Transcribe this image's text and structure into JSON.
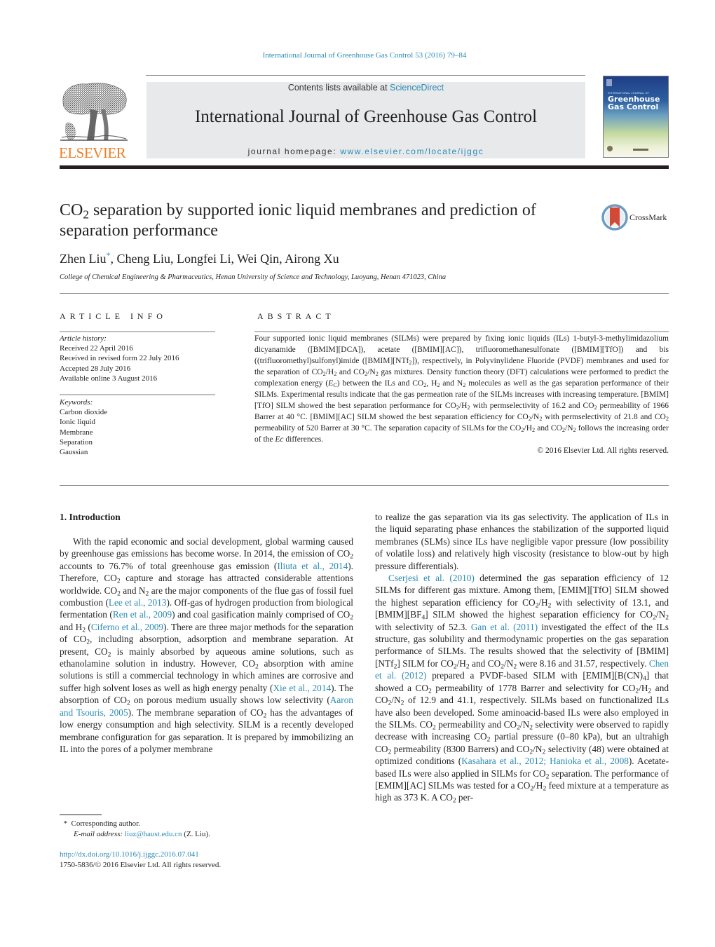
{
  "running_head": "International Journal of Greenhouse Gas Control 53 (2016) 79–84",
  "header": {
    "publisher_logo_text": "ELSEVIER",
    "contents_prefix": "Contents lists available at ",
    "contents_link": "ScienceDirect",
    "journal_title": "International Journal of Greenhouse Gas Control",
    "homepage_prefix": "journal homepage: ",
    "homepage_link": "www.elsevier.com/locate/ijggc",
    "cover": {
      "small_caption": "INTERNATIONAL JOURNAL OF",
      "title_line1": "Greenhouse",
      "title_line2": "Gas Control"
    },
    "colors": {
      "link": "#2a8bb5",
      "elsevier_orange": "#f07e26",
      "banner_bg": "#e8e9ea"
    }
  },
  "article": {
    "title_pre": "CO",
    "title_sub": "2",
    "title_post": " separation by supported ionic liquid membranes and prediction of separation performance",
    "crossmark_label": "CrossMark",
    "first_author": "Zhen Liu",
    "corresponding_mark": "*",
    "other_authors": ", Cheng Liu, Longfei Li, Wei Qin, Airong Xu",
    "affiliation": "College of Chemical Engineering & Pharmaceutics, Henan University of Science and Technology, Luoyang, Henan 471023, China"
  },
  "article_info": {
    "heading": "ARTICLE INFO",
    "history_label": "Article history:",
    "history": [
      "Received 22 April 2016",
      "Received in revised form 22 July 2016",
      "Accepted 28 July 2016",
      "Available online 3 August 2016"
    ],
    "keywords_label": "Keywords:",
    "keywords": [
      "Carbon dioxide",
      "Ionic liquid",
      "Membrane",
      "Separation",
      "Gaussian"
    ]
  },
  "abstract": {
    "heading": "ABSTRACT",
    "text_html": "Four supported ionic liquid membranes (SILMs) were prepared by fixing ionic liquids (ILs) 1-butyl-3-methylimidazolium dicyanamide ([BMIM][DCA]), acetate ([BMIM][AC]), trifluoromethanesulfonate ([BMIM][TfO]) and bis ((trifluoromethyl)sulfonyl)imide ([BMIM][NTf<span class=\"sub\">2</span>]), respectively, in Polyvinylidene Fluoride (PVDF) membranes and used for the separation of CO<span class=\"sub\">2</span>/H<span class=\"sub\">2</span> and CO<span class=\"sub\">2</span>/N<span class=\"sub\">2</span> gas mixtures. Density function theory (DFT) calculations were performed to predict the complexation energy (<i>E<span class=\"sub\">C</span></i>) between the ILs and CO<span class=\"sub\">2</span>, H<span class=\"sub\">2</span> and N<span class=\"sub\">2</span> molecules as well as the gas separation performance of their SILMs. Experimental results indicate that the gas permeation rate of the SILMs increases with increasing temperature. [BMIM][TfO] SILM showed the best separation performance for CO<span class=\"sub\">2</span>/H<span class=\"sub\">2</span> with permselectivity of 16.2 and CO<span class=\"sub\">2</span> permeability of 1966 Barrer at 40 °C. [BMIM][AC] SILM showed the best separation efficiency for CO<span class=\"sub\">2</span>/N<span class=\"sub\">2</span> with permselectivity of 21.8 and CO<span class=\"sub\">2</span> permeability of 520 Barrer at 30 °C. The separation capacity of SILMs for the CO<span class=\"sub\">2</span>/H<span class=\"sub\">2</span> and CO<span class=\"sub\">2</span>/N<span class=\"sub\">2</span> follows the increasing order of the <i>Ec</i> differences.",
    "copyright": "© 2016 Elsevier Ltd. All rights reserved."
  },
  "body": {
    "section_heading": "1.  Introduction",
    "left_col_html": "With the rapid economic and social development, global warm&shy;ing caused by greenhouse gas emissions has become worse. In 2014, the emission of CO<span class=\"sub\">2</span> accounts to 76.7% of total greenhouse gas emis&shy;sion (<a class=\"link\">Iliuta et al., 2014</a>). Therefore, CO<span class=\"sub\">2</span> capture and storage has attracted considerable attentions worldwide. CO<span class=\"sub\">2</span> and N<span class=\"sub\">2</span> are the major components of the flue gas of fossil fuel combustion (<a class=\"link\">Lee et al., 2013</a>). Off-gas of hydrogen production from biological fer&shy;mentation (<a class=\"link\">Ren et al., 2009</a>) and coal gasification mainly comprised of CO<span class=\"sub\">2</span> and H<span class=\"sub\">2</span> (<a class=\"link\">Ciferno et al., 2009</a>). There are three major meth&shy;ods for the separation of CO<span class=\"sub\">2</span>, including absorption, adsorption and membrane separation. At present, CO<span class=\"sub\">2</span> is mainly absorbed by aque&shy;ous amine solutions, such as ethanolamine solution in industry. However, CO<span class=\"sub\">2</span> absorption with amine solutions is still a commercial technology in which amines are corrosive and suffer high solvent loses as well as high energy penalty (<a class=\"link\">Xie et al., 2014</a>). The absorption of CO<span class=\"sub\">2</span> on porous medium usually shows low selectivity (<a class=\"link\">Aaron and Tsouris, 2005</a>). The membrane separation of CO<span class=\"sub\">2</span> has the advantages of low energy consumption and high selectivity. SILM is a recently developed membrane configuration for gas separation. It is pre&shy;pared by immobilizing an IL into the pores of a polymer membrane",
    "right_col_p1_html": "to realize the gas separation via its gas selectivity. The application of ILs in the liquid separating phase enhances the stabilization of the supported liquid membranes (SLMs) since ILs have negligible vapor pressure (low possibility of volatile loss) and relatively high viscosity (resistance to blow-out by high pressure differentials).",
    "right_col_p2_html": "<a class=\"link\">Cserjesi et al. (2010)</a> determined the gas separation efficiency of 12 SILMs for different gas mixture. Among them, [EMIM][TfO] SILM showed the highest separation efficiency for CO<span class=\"sub\">2</span>/H<span class=\"sub\">2</span> with selectivity of 13.1, and [BMIM][BF<span class=\"sub\">4</span>] SILM showed the highest sep&shy;aration efficiency for CO<span class=\"sub\">2</span>/N<span class=\"sub\">2</span> with selectivity of 52.3. <a class=\"link\">Gan et al. (2011)</a> investigated the effect of the ILs structure, gas solubility and thermodynamic properties on the gas separation performance of SILMs. The results showed that the selectivity of [BMIM][NTf<span class=\"sub\">2</span>] SILM for CO<span class=\"sub\">2</span>/H<span class=\"sub\">2</span> and CO<span class=\"sub\">2</span>/N<span class=\"sub\">2</span> were 8.16 and 31.57, respectively. <a class=\"link\">Chen et al. (2012)</a> prepared a PVDF-based SILM with [EMIM][B(CN)<span class=\"sub\">4</span>] that showed a CO<span class=\"sub\">2</span> permeability of 1778 Barrer and selectivity for CO<span class=\"sub\">2</span>/H<span class=\"sub\">2</span> and CO<span class=\"sub\">2</span>/N<span class=\"sub\">2</span> of 12.9 and 41.1, respectively. SILMs based on functionalized ILs have also been developed. Some aminoacid-based ILs were also employed in the SILMs. CO<span class=\"sub\">2</span> permeability and CO<span class=\"sub\">2</span>/N<span class=\"sub\">2</span> selectivity were observed to rapidly decrease with increasing CO<span class=\"sub\">2</span> partial pressure (0–80 kPa), but an ultrahigh CO<span class=\"sub\">2</span> permeability (8300 Barrers) and CO<span class=\"sub\">2</span>/N<span class=\"sub\">2</span> selectivity (48) were obtained at optimized conditions (<a class=\"link\">Kasahara et al., 2012; Hanioka et al., 2008</a>). Acetate-based ILs were also applied in SILMs for CO<span class=\"sub\">2</span> separation. The performance of [EMIM][AC] SILMs was tested for a CO<span class=\"sub\">2</span>/H<span class=\"sub\">2</span> feed mixture at a temperature as high as 373 K. A CO<span class=\"sub\">2</span> per-"
  },
  "footnote": {
    "mark": "*",
    "corresponding": "Corresponding author.",
    "email_label": "E-mail address:",
    "email": "liuz@haust.edu.cn",
    "email_suffix": " (Z. Liu)."
  },
  "doi": {
    "url": "http://dx.doi.org/10.1016/j.ijggc.2016.07.041",
    "issn_line": "1750-5836/© 2016 Elsevier Ltd. All rights reserved."
  }
}
